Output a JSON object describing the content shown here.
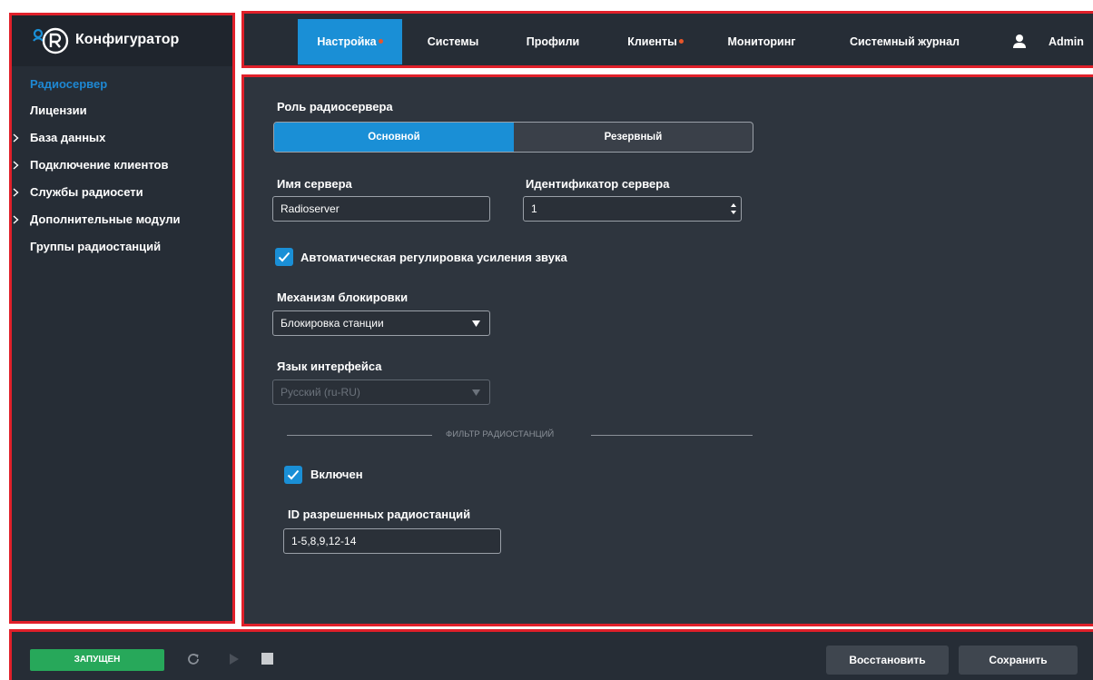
{
  "app": {
    "title": "Конфигуратор"
  },
  "sidebar": {
    "items": [
      {
        "label": "Радиосервер",
        "active": true,
        "expandable": false
      },
      {
        "label": "Лицензии",
        "active": false,
        "expandable": false
      },
      {
        "label": "База данных",
        "active": false,
        "expandable": true
      },
      {
        "label": "Подключение клиентов",
        "active": false,
        "expandable": true
      },
      {
        "label": "Службы радиосети",
        "active": false,
        "expandable": true
      },
      {
        "label": "Дополнительные модули",
        "active": false,
        "expandable": true
      },
      {
        "label": "Группы радиостанций",
        "active": false,
        "expandable": false
      }
    ]
  },
  "topnav": {
    "tabs": [
      {
        "label": "Настройка",
        "active": true,
        "dot": true
      },
      {
        "label": "Системы",
        "active": false,
        "dot": false
      },
      {
        "label": "Профили",
        "active": false,
        "dot": false
      },
      {
        "label": "Клиенты",
        "active": false,
        "dot": true
      },
      {
        "label": "Мониторинг",
        "active": false,
        "dot": false
      },
      {
        "label": "Системный журнал",
        "active": false,
        "dot": false
      }
    ],
    "user": "Admin"
  },
  "form": {
    "role": {
      "label": "Роль радиосервера",
      "options": [
        "Основной",
        "Резервный"
      ],
      "selected": "Основной"
    },
    "server_name": {
      "label": "Имя сервера",
      "value": "Radioserver"
    },
    "server_id": {
      "label": "Идентификатор сервера",
      "value": "1"
    },
    "agc": {
      "label": "Автоматическая регулировка усиления звука",
      "checked": true
    },
    "lock": {
      "label": "Механизм блокировки",
      "value": "Блокировка станции"
    },
    "language": {
      "label": "Язык интерфейса",
      "value": "Русский (ru-RU)",
      "disabled": true
    },
    "filter": {
      "title": "ФИЛЬТР РАДИОСТАНЦИЙ",
      "enabled": {
        "label": "Включен",
        "checked": true
      },
      "ids": {
        "label": "ID разрешенных радиостанций",
        "value": "1-5,8,9,12-14"
      }
    }
  },
  "footer": {
    "status": "ЗАПУЩЕН",
    "restore_label": "Восстановить",
    "save_label": "Сохранить"
  },
  "colors": {
    "accent": "#1a8fd6",
    "status_running": "#27a85a",
    "notification_dot": "#e8562a",
    "highlight_border": "#e0202a"
  }
}
